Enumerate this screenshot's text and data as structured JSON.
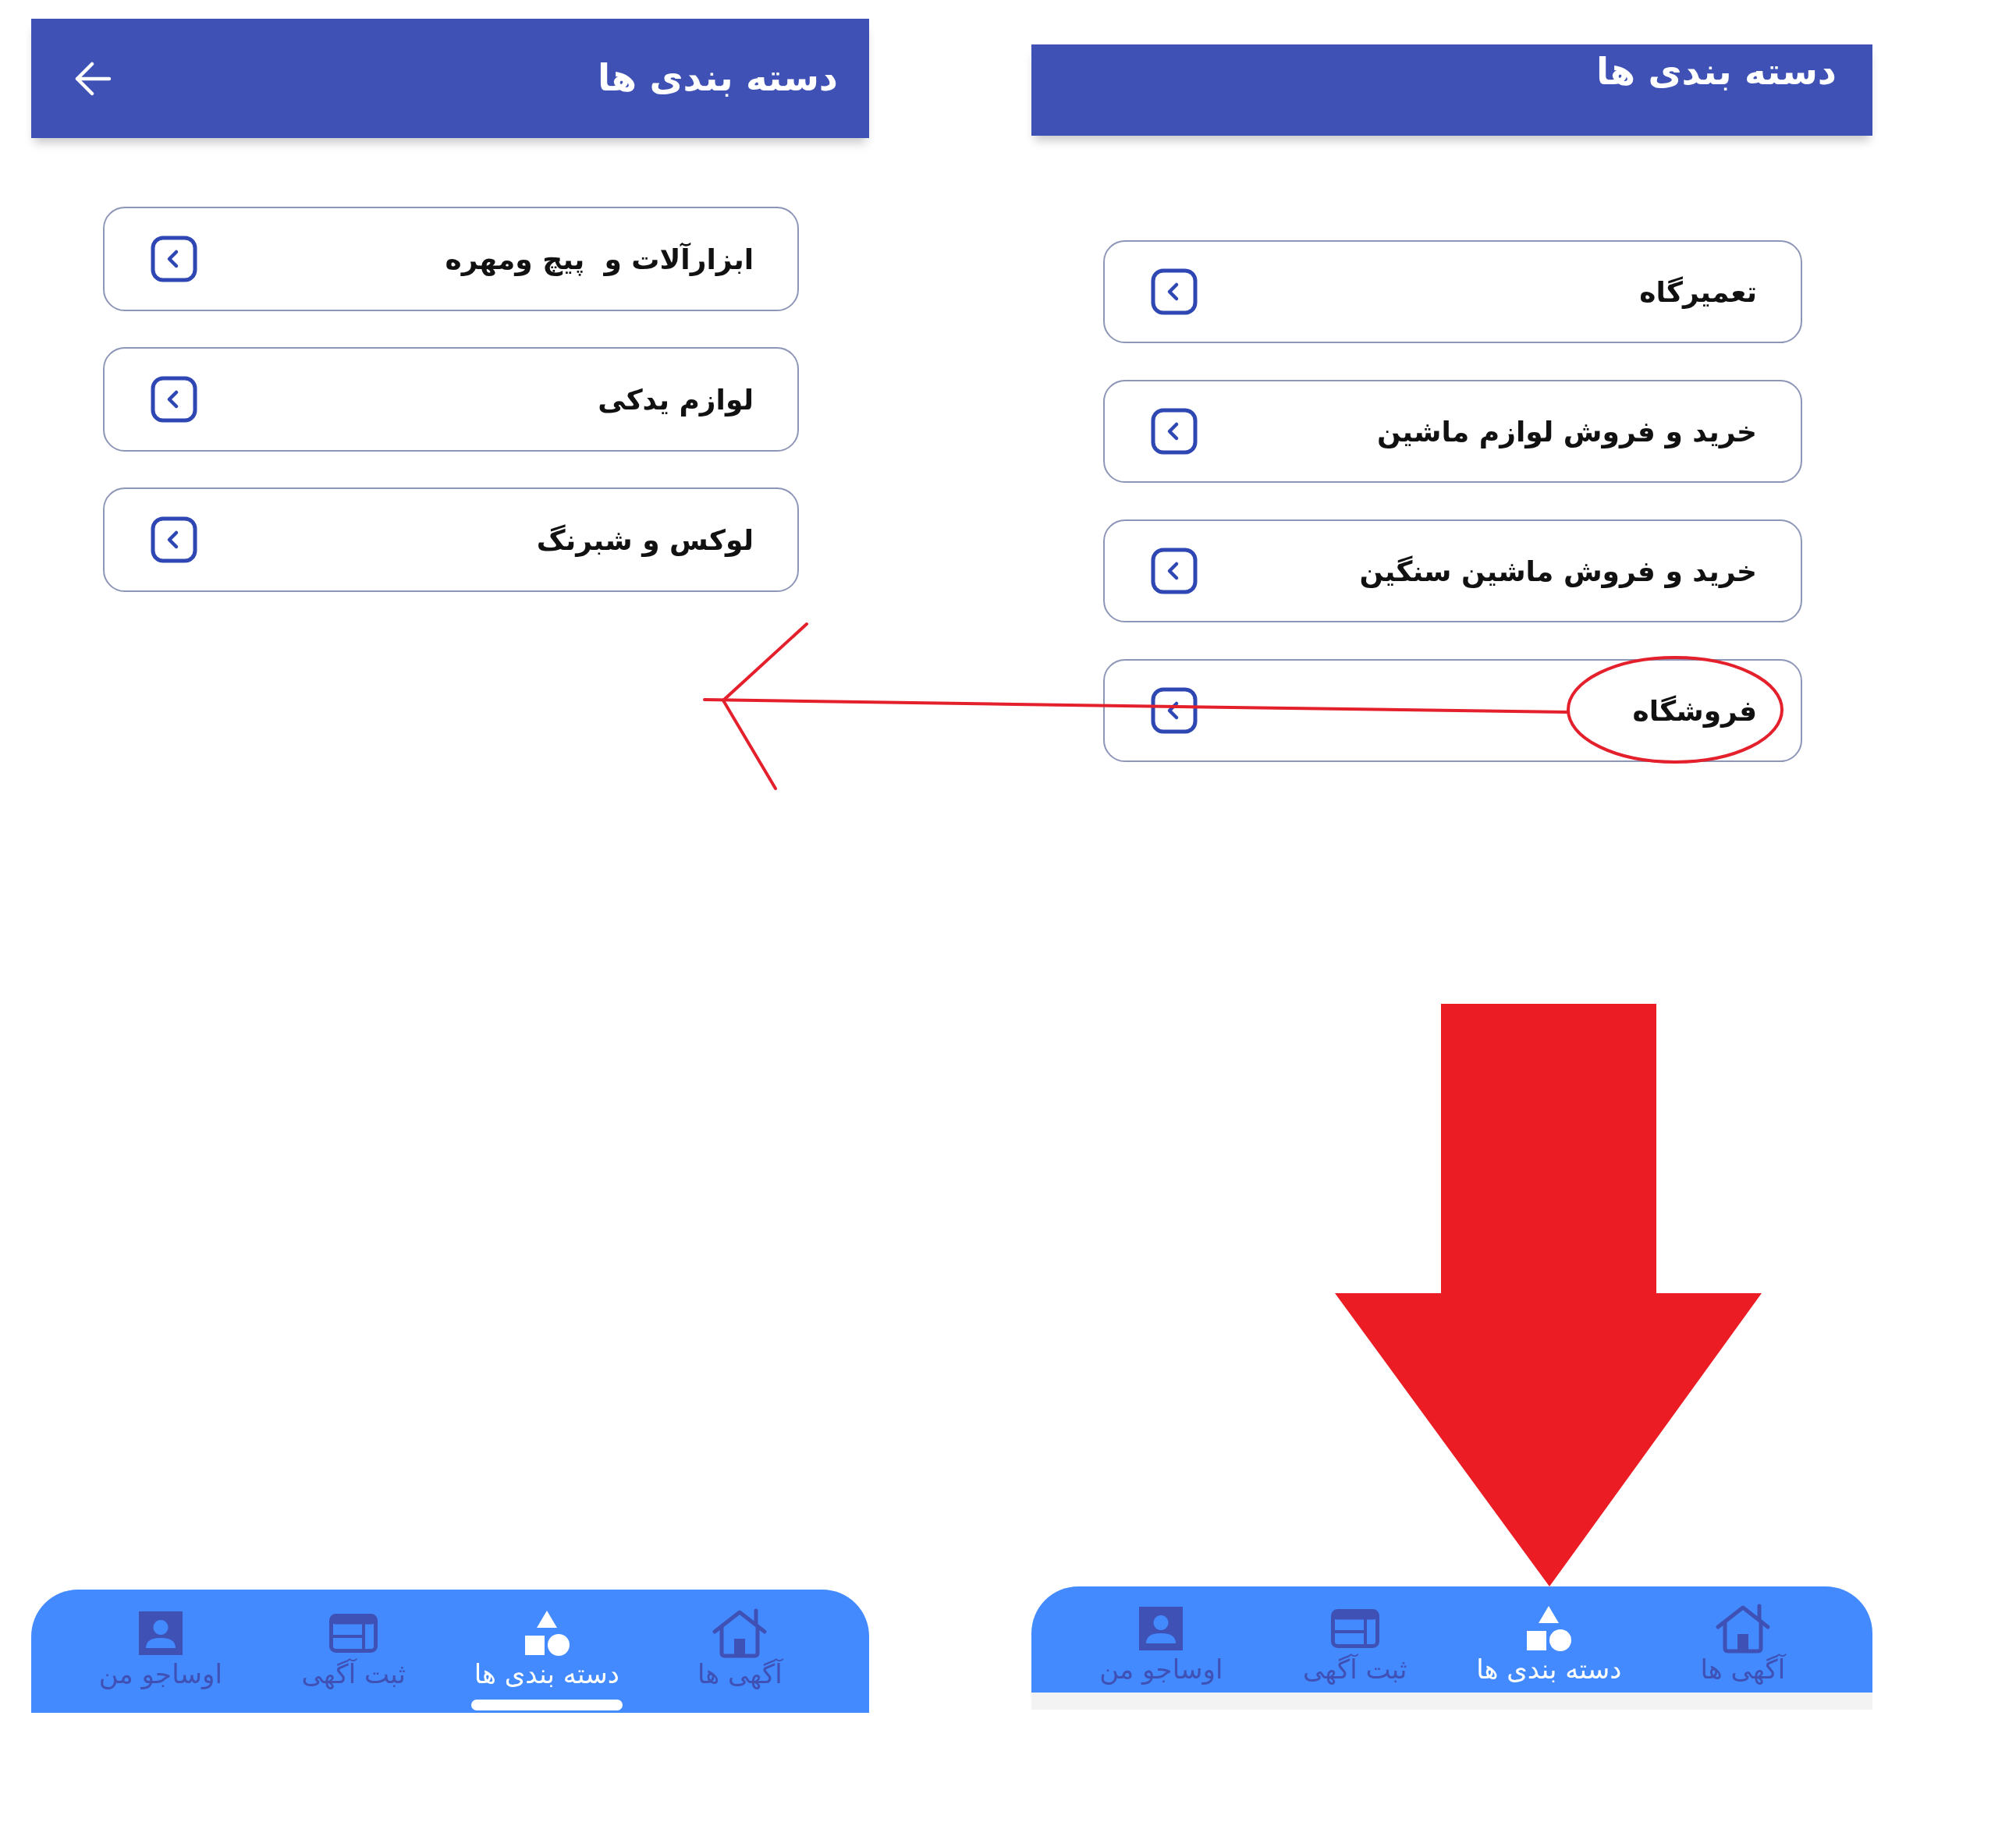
{
  "screens": [
    {
      "header": {
        "title": "دسته بندی ها",
        "back_button": false
      },
      "categories": [
        "تعمیرگاه",
        "خرید و فروش لوازم ماشین",
        "خرید و فروش ماشین سنگین",
        "فروشگاه"
      ],
      "bottom_nav": {
        "indicator": false,
        "strip": true,
        "items": [
          {
            "label": "آگهی ها",
            "selected": false
          },
          {
            "label": "دسته بندی ها",
            "selected": true
          },
          {
            "label": "ثبت آگهی",
            "selected": false
          },
          {
            "label": "اوساجو من",
            "selected": false
          }
        ]
      }
    },
    {
      "header": {
        "title": "دسته بندی ها",
        "back_button": true
      },
      "categories": [
        "ابزارآلات و  پیچ ومهره",
        "لوازم یدکی",
        "لوکس و شبرنگ"
      ],
      "bottom_nav": {
        "indicator": true,
        "strip": false,
        "items": [
          {
            "label": "آگهی ها",
            "selected": false
          },
          {
            "label": "دسته بندی ها",
            "selected": true
          },
          {
            "label": "ثبت آگهی",
            "selected": false
          },
          {
            "label": "اوساجو من",
            "selected": false
          }
        ]
      }
    }
  ]
}
